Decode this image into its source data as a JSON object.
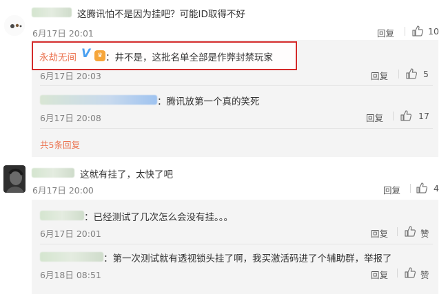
{
  "comments": [
    {
      "text": "这腾讯怕不是因为挂吧？可能ID取得不好",
      "time": "6月17日 20:01",
      "reply": "回复",
      "likes": "10",
      "replies": [
        {
          "name": "永劫无间",
          "text": "：井不是，这批名单全部是作弊封禁玩家",
          "time": "6月17日 20:03",
          "reply": "回复",
          "likes": "5"
        },
        {
          "text": "：腾讯放第一个真的笑死",
          "time": "6月17日 20:08",
          "reply": "回复",
          "likes": "17"
        }
      ],
      "more": "共5条回复"
    },
    {
      "text": "这就有挂了，太快了吧",
      "time": "6月17日 20:00",
      "reply": "回复",
      "likes": "4",
      "replies": [
        {
          "text": "：已经测试了几次怎么会没有挂。。。",
          "time": "6月17日 20:01",
          "reply": "回复",
          "likes": "赞"
        },
        {
          "text": "：第一次测试就有透视锁头挂了啊，我买激活码进了个辅助群，举报了",
          "time": "6月18日 08:51",
          "reply": "回复",
          "likes": "赞"
        }
      ]
    }
  ],
  "colors": {
    "accent": "#eb7350",
    "highlight": "#d42a2a",
    "verified": "#4a9ff0"
  }
}
